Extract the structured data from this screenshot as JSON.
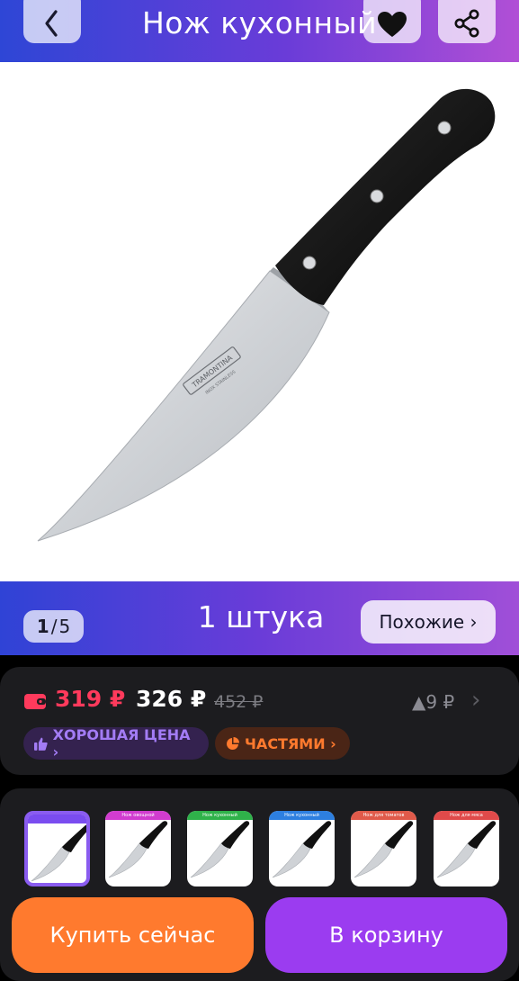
{
  "header": {
    "title": "Нож кухонный",
    "back_icon": "chevron-left-icon",
    "favorite_icon": "heart-icon",
    "share_icon": "share-icon"
  },
  "gallery": {
    "current": "1",
    "separator": "/",
    "total": "5",
    "quantity": "1 штука",
    "similar_label": "Похожие ›",
    "photo_brand": "TRAMONTINA",
    "photo_brand_sub": "INOX   STAINLESS"
  },
  "price": {
    "card_price": "319 ₽",
    "price": "326 ₽",
    "old_price": "452 ₽",
    "delta": "▲9 ₽",
    "chevron": "›",
    "card_price_color": "#ff3a5c",
    "good_price_badge": "ХОРОШАЯ ЦЕНА ›",
    "parts_badge": "ЧАСТЯМИ ›"
  },
  "thumbnails": [
    {
      "label": "",
      "color": "#7a4cf0",
      "selected": true
    },
    {
      "label": "Нож овощной",
      "color": "#d13ccf",
      "selected": false
    },
    {
      "label": "Нож кухонный",
      "color": "#2fb24a",
      "selected": false
    },
    {
      "label": "Нож кухонный",
      "color": "#2d7fe0",
      "selected": false
    },
    {
      "label": "Нож для томатов",
      "color": "#e05a4a",
      "selected": false
    },
    {
      "label": "Нож для мяса",
      "color": "#e04a4a",
      "selected": false
    }
  ],
  "actions": {
    "buy_now": "Купить сейчас",
    "add_to_cart": "В корзину",
    "buy_color": "#ff7a2e",
    "cart_color": "#9b3cf0"
  }
}
